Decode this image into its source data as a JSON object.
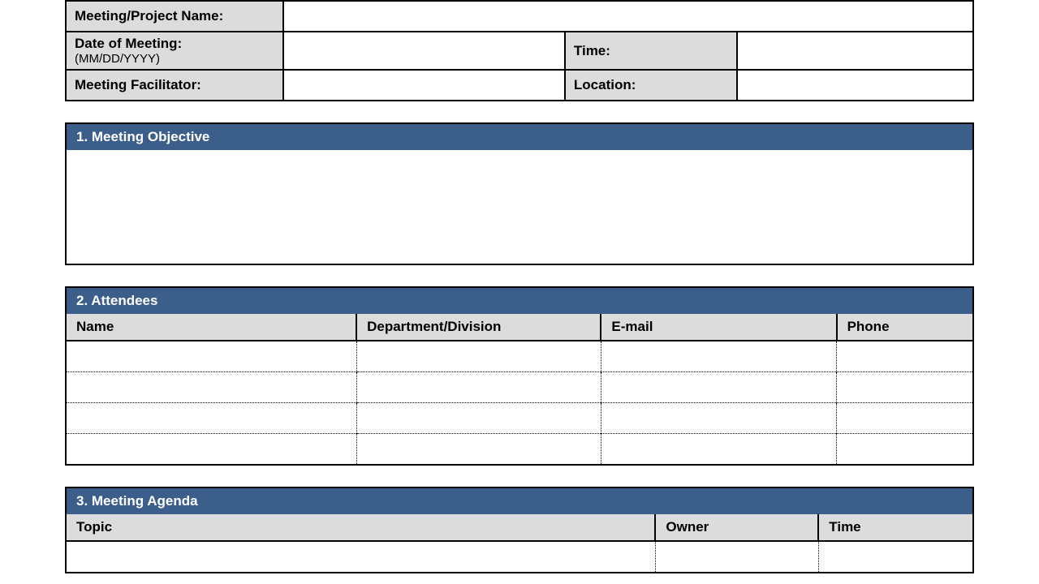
{
  "header": {
    "project_name_label": "Meeting/Project Name:",
    "project_name_value": "",
    "date_label": "Date of Meeting:",
    "date_hint": "(MM/DD/YYYY)",
    "date_value": "",
    "time_label": "Time:",
    "time_value": "",
    "facilitator_label": "Meeting Facilitator:",
    "facilitator_value": "",
    "location_label": "Location:",
    "location_value": ""
  },
  "sections": {
    "objective": {
      "title": "1. Meeting Objective",
      "body": ""
    },
    "attendees": {
      "title": "2. Attendees",
      "columns": [
        "Name",
        "Department/Division",
        "E-mail",
        "Phone"
      ],
      "rows": [
        [
          "",
          "",
          "",
          ""
        ],
        [
          "",
          "",
          "",
          ""
        ],
        [
          "",
          "",
          "",
          ""
        ],
        [
          "",
          "",
          "",
          ""
        ]
      ]
    },
    "agenda": {
      "title": "3. Meeting Agenda",
      "columns": [
        "Topic",
        "Owner",
        "Time"
      ],
      "rows": [
        [
          "",
          "",
          ""
        ]
      ]
    }
  }
}
